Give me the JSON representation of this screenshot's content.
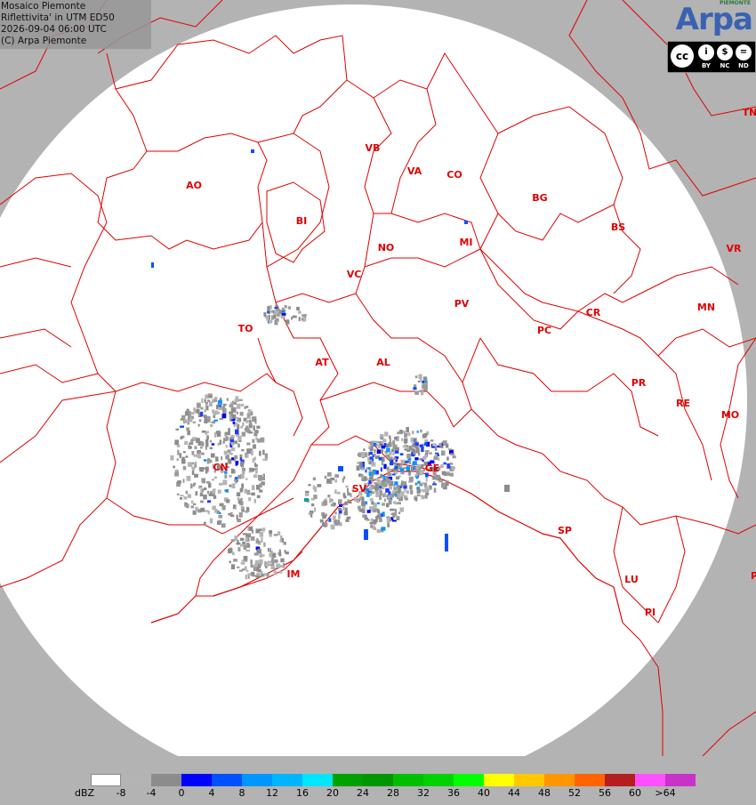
{
  "info": {
    "line1": "Mosaico Piemonte",
    "line2": "Riflettivita' in UTM ED50",
    "line3": "2026-09-04 06:00 UTC",
    "line4": "(C) Arpa Piemonte"
  },
  "logo": {
    "name": "Arpa",
    "region": "PIEMONTE"
  },
  "license": {
    "logo": "cc",
    "terms": [
      "BY",
      "NC",
      "ND"
    ],
    "icons": [
      "attribution-icon",
      "noncommercial-icon",
      "noderivatives-icon"
    ]
  },
  "provinces": [
    {
      "code": "VB"
    },
    {
      "code": "VA"
    },
    {
      "code": "CO"
    },
    {
      "code": "BG"
    },
    {
      "code": "AO"
    },
    {
      "code": "BI"
    },
    {
      "code": "BS"
    },
    {
      "code": "NO"
    },
    {
      "code": "MI"
    },
    {
      "code": "VR"
    },
    {
      "code": "VC"
    },
    {
      "code": "PV"
    },
    {
      "code": "CR"
    },
    {
      "code": "MN"
    },
    {
      "code": "TO"
    },
    {
      "code": "PC"
    },
    {
      "code": "AT"
    },
    {
      "code": "AL"
    },
    {
      "code": "PR"
    },
    {
      "code": "RE"
    },
    {
      "code": "MO"
    },
    {
      "code": "CN"
    },
    {
      "code": "GE"
    },
    {
      "code": "SV"
    },
    {
      "code": "SP"
    },
    {
      "code": "IM"
    },
    {
      "code": "LU"
    },
    {
      "code": "PI"
    },
    {
      "code": "TN"
    },
    {
      "code": "P"
    }
  ],
  "legend": {
    "unit": "dBZ",
    "colors": [
      "#ffffff",
      "#b4b4b4",
      "#8c8c8c",
      "#0000ff",
      "#0050ff",
      "#0096ff",
      "#00b4ff",
      "#00e6ff",
      "#00a000",
      "#009600",
      "#00be00",
      "#00d200",
      "#00ff00",
      "#ffff00",
      "#ffc800",
      "#ff9600",
      "#ff6400",
      "#b41e1e",
      "#ff50ff",
      "#c832c8"
    ],
    "labels": [
      "-8",
      "-4",
      "0",
      "4",
      "8",
      "12",
      "16",
      "20",
      "24",
      "28",
      "32",
      "36",
      "40",
      "44",
      "48",
      "52",
      "56",
      "60",
      ">64"
    ]
  },
  "colors": {
    "border": "#e00000",
    "outside_coverage": "#b3b3b3",
    "coverage": "#ffffff"
  }
}
